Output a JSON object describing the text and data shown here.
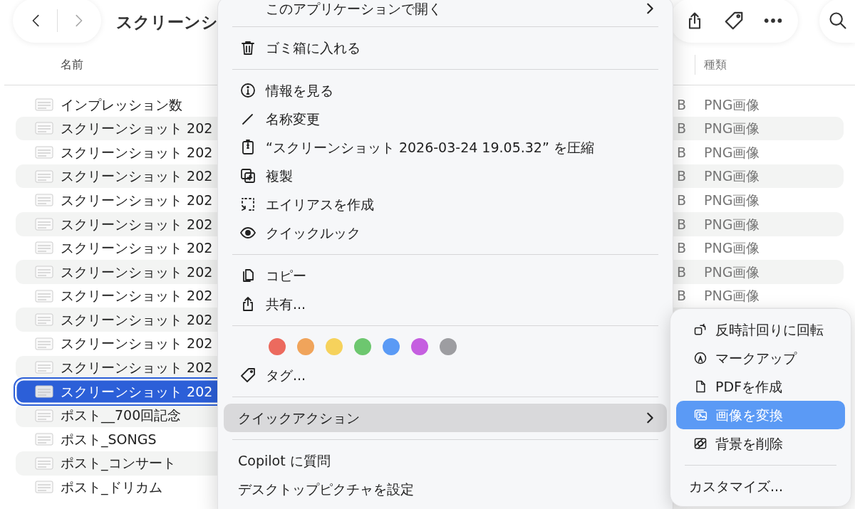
{
  "toolbar": {
    "title": "スクリーンシ"
  },
  "columns": {
    "name": "名前",
    "type": "種類"
  },
  "files": [
    {
      "name": "インプレッション数",
      "selected": false
    },
    {
      "name": "スクリーンショット 202",
      "selected": false
    },
    {
      "name": "スクリーンショット 202",
      "selected": false
    },
    {
      "name": "スクリーンショット 202",
      "selected": false
    },
    {
      "name": "スクリーンショット 202",
      "selected": false
    },
    {
      "name": "スクリーンショット 202",
      "selected": false
    },
    {
      "name": "スクリーンショット 202",
      "selected": false
    },
    {
      "name": "スクリーンショット 202",
      "selected": false
    },
    {
      "name": "スクリーンショット 202",
      "selected": false
    },
    {
      "name": "スクリーンショット 202",
      "selected": false
    },
    {
      "name": "スクリーンショット 202",
      "selected": false
    },
    {
      "name": "スクリーンショット 202",
      "selected": false
    },
    {
      "name": "スクリーンショット 202",
      "selected": true
    },
    {
      "name": "ポスト__700回記念",
      "selected": false
    },
    {
      "name": "ポスト_SONGS",
      "selected": false
    },
    {
      "name": "ポスト_コンサート",
      "selected": false
    },
    {
      "name": "ポスト_ドリカム",
      "selected": false
    }
  ],
  "type_cells": [
    {
      "size": "B",
      "type": "PNG画像"
    },
    {
      "size": "B",
      "type": "PNG画像"
    },
    {
      "size": "B",
      "type": "PNG画像"
    },
    {
      "size": "B",
      "type": "PNG画像"
    },
    {
      "size": "B",
      "type": "PNG画像"
    },
    {
      "size": "B",
      "type": "PNG画像"
    },
    {
      "size": "B",
      "type": "PNG画像"
    },
    {
      "size": "B",
      "type": "PNG画像"
    },
    {
      "size": "B",
      "type": "PNG画像"
    }
  ],
  "context_menu": {
    "items": [
      {
        "kind": "item",
        "label": "このアプリケーションで開く",
        "submenu": true,
        "expanded": false
      },
      {
        "kind": "separator"
      },
      {
        "kind": "item",
        "label": "ゴミ箱に入れる"
      },
      {
        "kind": "separator"
      },
      {
        "kind": "item",
        "label": "情報を見る"
      },
      {
        "kind": "item",
        "label": "名称変更"
      },
      {
        "kind": "item",
        "label": "“スクリーンショット 2026-03-24 19.05.32” を圧縮"
      },
      {
        "kind": "item",
        "label": "複製"
      },
      {
        "kind": "item",
        "label": "エイリアスを作成"
      },
      {
        "kind": "item",
        "label": "クイックルック"
      },
      {
        "kind": "separator"
      },
      {
        "kind": "item",
        "label": "コピー"
      },
      {
        "kind": "item",
        "label": "共有..."
      },
      {
        "kind": "separator"
      },
      {
        "kind": "colors",
        "colors": [
          {
            "color": "#ec6a5e"
          },
          {
            "color": "#f0a45b"
          },
          {
            "color": "#f6d25c"
          },
          {
            "color": "#6dc76f"
          },
          {
            "color": "#5a9af5"
          },
          {
            "color": "#c55fe0"
          },
          {
            "color": "#9d9da1"
          }
        ]
      },
      {
        "kind": "item",
        "label": "タグ..."
      },
      {
        "kind": "separator"
      },
      {
        "kind": "item",
        "label": "クイックアクション",
        "submenu": true,
        "expanded": true
      },
      {
        "kind": "separator"
      },
      {
        "kind": "item",
        "label": "Copilot に質問"
      },
      {
        "kind": "item",
        "label": "デスクトップピクチャを設定"
      }
    ]
  },
  "submenu": {
    "items": [
      {
        "kind": "item",
        "label": "反時計回りに回転",
        "selected": false
      },
      {
        "kind": "item",
        "label": "マークアップ",
        "selected": false
      },
      {
        "kind": "item",
        "label": "PDFを作成",
        "selected": false
      },
      {
        "kind": "item",
        "label": "画像を変換",
        "selected": true
      },
      {
        "kind": "item",
        "label": "背景を削除",
        "selected": false
      },
      {
        "kind": "separator"
      },
      {
        "kind": "item",
        "label": "カスタマイズ...",
        "selected": false
      }
    ]
  }
}
